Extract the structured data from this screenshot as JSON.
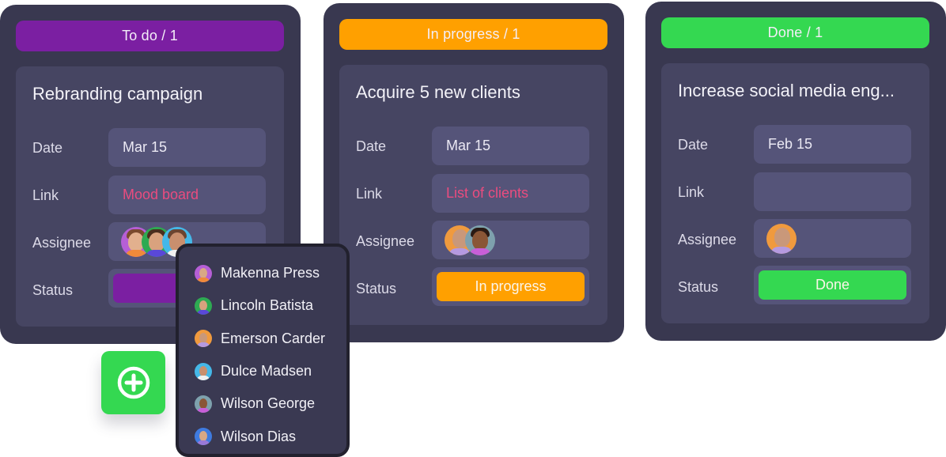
{
  "colors": {
    "todo": "#7b1fa2",
    "in_progress": "#ffa000",
    "done": "#34d851",
    "link": "#ea4c7f"
  },
  "labels": {
    "date": "Date",
    "link": "Link",
    "assignee": "Assignee",
    "status": "Status"
  },
  "columns": [
    {
      "header": "To do / 1",
      "card": {
        "title": "Rebranding campaign",
        "date": "Mar 15",
        "link": "Mood board",
        "assignees": [
          "Makenna Press",
          "Lincoln Batista",
          "Dulce Madsen"
        ],
        "status": "To do",
        "status_visible": "T"
      }
    },
    {
      "header": "In progress / 1",
      "card": {
        "title": "Acquire 5 new clients",
        "date": "Mar 15",
        "link": "List of clients",
        "assignees": [
          "Emerson Carder",
          "Wilson George"
        ],
        "status": "In progress"
      }
    },
    {
      "header": "Done / 1",
      "card": {
        "title": "Increase social media eng...",
        "date": "Feb 15",
        "link": "",
        "assignees": [
          "Emerson Carder"
        ],
        "status": "Done"
      }
    }
  ],
  "assignee_dropdown": {
    "options": [
      {
        "name": "Makenna Press",
        "avatar": "avatar-makenna-press"
      },
      {
        "name": "Lincoln Batista",
        "avatar": "avatar-lincoln-batista"
      },
      {
        "name": "Emerson Carder",
        "avatar": "avatar-emerson-carder"
      },
      {
        "name": "Dulce Madsen",
        "avatar": "avatar-dulce-madsen"
      },
      {
        "name": "Wilson George",
        "avatar": "avatar-wilson-george"
      },
      {
        "name": "Wilson Dias",
        "avatar": "avatar-wilson-dias"
      }
    ]
  },
  "add_button": {
    "icon": "plus-circle-icon"
  }
}
